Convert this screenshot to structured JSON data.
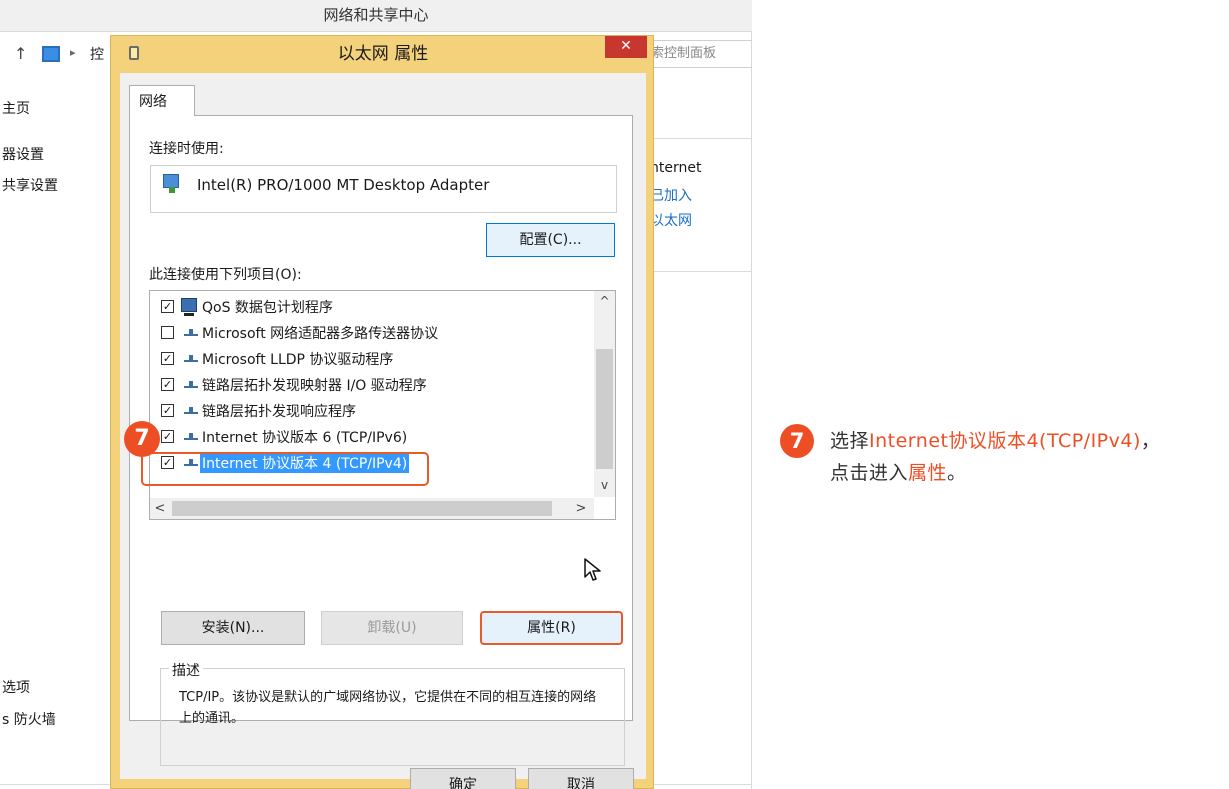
{
  "background_window": {
    "title": "网络和共享中心",
    "up_arrow": "↑",
    "breadcrumb_sep": "▸",
    "address_text": "控",
    "search_placeholder": "索控制面板",
    "left_links": [
      "主页",
      "器设置",
      "共享设置",
      "选项",
      "s 防火墙"
    ],
    "right_texts": [
      "nternet",
      "已加入",
      "以太网"
    ]
  },
  "dialog": {
    "title": "以太网 属性",
    "close": "✕",
    "tab_label": "网络",
    "connect_using_label": "连接时使用:",
    "adapter_name": "Intel(R) PRO/1000 MT Desktop Adapter",
    "config_button": "配置(C)...",
    "items_label": "此连接使用下列项目(O):",
    "items": [
      {
        "checked": true,
        "label": "QoS 数据包计划程序"
      },
      {
        "checked": false,
        "label": "Microsoft 网络适配器多路传送器协议"
      },
      {
        "checked": true,
        "label": "Microsoft LLDP 协议驱动程序"
      },
      {
        "checked": true,
        "label": "链路层拓扑发现映射器 I/O 驱动程序"
      },
      {
        "checked": true,
        "label": "链路层拓扑发现响应程序"
      },
      {
        "checked": true,
        "label": "Internet 协议版本 6 (TCP/IPv6)"
      },
      {
        "checked": true,
        "label": "Internet 协议版本 4 (TCP/IPv4)",
        "selected": true
      }
    ],
    "install_button": "安装(N)...",
    "uninstall_button": "卸载(U)",
    "properties_button": "属性(R)",
    "description_legend": "描述",
    "description_text": "TCP/IP。该协议是默认的广域网络协议，它提供在不同的相互连接的网络上的通讯。",
    "ok_button": "确定",
    "cancel_button": "取消",
    "step_badge": "7",
    "check_mark": "✓",
    "scroll_up": "^",
    "scroll_down": "v",
    "scroll_left": "<",
    "scroll_right": ">"
  },
  "instruction": {
    "step_badge": "7",
    "line1_prefix": "选择",
    "line1_highlight": "Internet协议版本4(TCP/IPv4)",
    "line1_suffix": "，",
    "line2_prefix": "点击进入",
    "line2_highlight": "属性",
    "line2_suffix": "。"
  },
  "colors": {
    "accent": "#ee4e24",
    "selection": "#3399ff",
    "dialog_frame": "#f4d27c",
    "close_button": "#c7372f"
  }
}
